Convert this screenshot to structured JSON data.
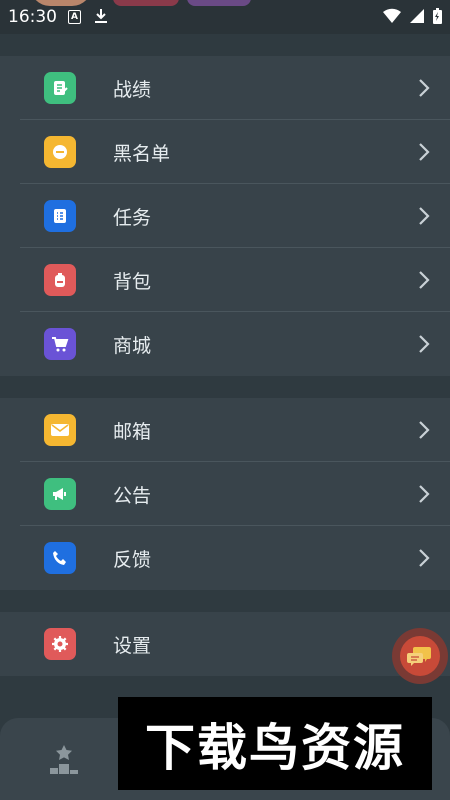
{
  "status_bar": {
    "time": "16:30",
    "a_badge": "A"
  },
  "colors": {
    "background": "#2f3a40",
    "row_bg": "#38434a",
    "green": "#3fbf7f",
    "yellow": "#f5b731",
    "blue": "#1f6fe0",
    "red": "#e05a5a",
    "purple": "#6a53d6",
    "chat_red": "#c84a38"
  },
  "menu": {
    "group1": [
      {
        "label": "战绩",
        "icon": "scoreboard-icon",
        "color": "#3fbf7f"
      },
      {
        "label": "黑名单",
        "icon": "block-icon",
        "color": "#f5b731"
      },
      {
        "label": "任务",
        "icon": "task-list-icon",
        "color": "#1f6fe0"
      },
      {
        "label": "背包",
        "icon": "backpack-icon",
        "color": "#e05a5a"
      },
      {
        "label": "商城",
        "icon": "cart-icon",
        "color": "#6a53d6"
      }
    ],
    "group2": [
      {
        "label": "邮箱",
        "icon": "mail-icon",
        "color": "#f5b731"
      },
      {
        "label": "公告",
        "icon": "megaphone-icon",
        "color": "#3fbf7f"
      },
      {
        "label": "反馈",
        "icon": "phone-icon",
        "color": "#1f6fe0"
      }
    ],
    "group3": [
      {
        "label": "设置",
        "icon": "settings-icon",
        "color": "#e05a5a"
      }
    ]
  },
  "watermark": "下载鸟资源"
}
